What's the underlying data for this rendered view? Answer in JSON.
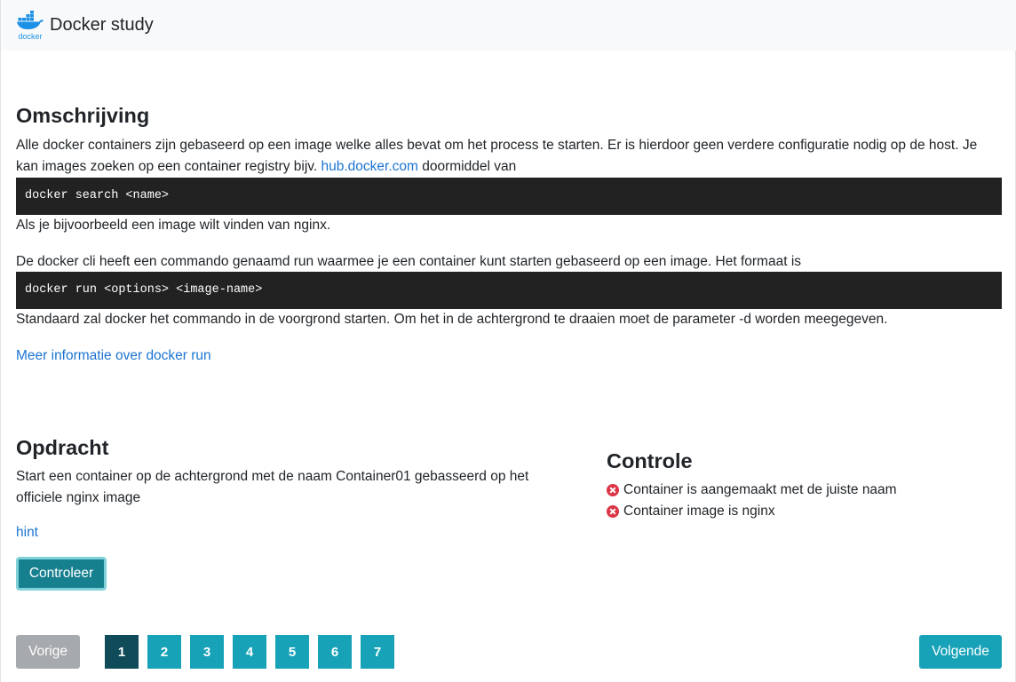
{
  "navbar": {
    "brand": "Docker study",
    "logo_text": "docker"
  },
  "description": {
    "title": "Omschrijving",
    "intro_before_link": "Alle docker containers zijn gebaseerd op een image welke alles bevat om het process te starten. Er is hierdoor geen verdere configuratie nodig op de host. Je kan images zoeken op een container registry bijv. ",
    "intro_link": "hub.docker.com",
    "intro_after_link": " doormiddel van",
    "code_search": "docker search <name>",
    "search_note": "Als je bijvoorbeeld een image wilt vinden van nginx.",
    "run_intro": "De docker cli heeft een commando genaamd run waarmee je een container kunt starten gebaseerd op een image. Het formaat is",
    "code_run": "docker run <options> <image-name>",
    "run_note": "Standaard zal docker het commando in de voorgrond starten. Om het in de achtergrond te draaien moet de parameter -d worden meegegeven.",
    "more_info_link": "Meer informatie over docker run"
  },
  "assignment": {
    "title": "Opdracht",
    "text": "Start een container op de achtergrond met de naam Container01 gebasseerd op het officiele nginx image",
    "hint_link": "hint",
    "check_button": "Controleer"
  },
  "control": {
    "title": "Controle",
    "items": [
      {
        "label": "Container is aangemaakt met de juiste naam",
        "status": "failed"
      },
      {
        "label": "Container image is nginx",
        "status": "failed"
      }
    ]
  },
  "pagination": {
    "prev": "Vorige",
    "next": "Volgende",
    "pages": [
      "1",
      "2",
      "3",
      "4",
      "5",
      "6",
      "7"
    ],
    "active_page": "1"
  },
  "colors": {
    "accent": "#17a2b8",
    "active_page": "#0f4b58",
    "link": "#1b74d3",
    "error": "#dc3545",
    "code_bg": "#222222"
  }
}
